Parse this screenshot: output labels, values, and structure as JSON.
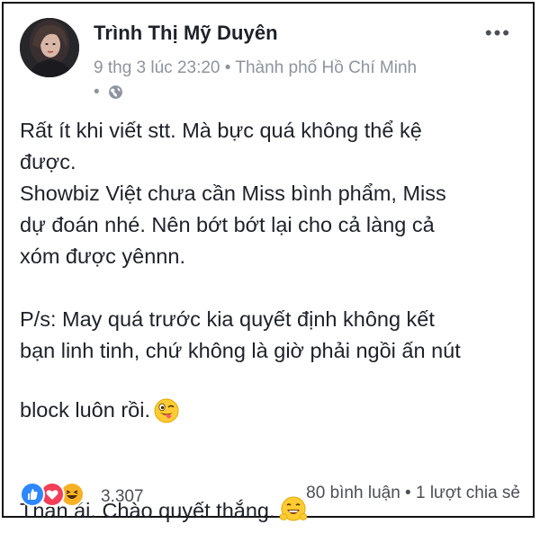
{
  "post": {
    "author": "Trình Thị Mỹ Duyên",
    "timestamp": "9 thg 3 lúc 23:20",
    "separator": "•",
    "location": "Thành phố Hồ Chí Minh",
    "privacy_separator": "•",
    "paragraphs": [
      "Rất ít khi viết stt. Mà bực quá không thể kệ\nđược.\nShowbiz Việt chưa cần Miss bình phẩm, Miss\ndự đoán nhé. Nên bớt bớt lại cho cả làng cả\nxóm được yênnn.",
      "P/s: May quá trước kia quyết định không kết\nbạn linh tinh, chứ không là giờ phải ngồi ấn nút\nblock luôn rồi.",
      "Thân ái. Chào quyết thắng."
    ]
  },
  "menu_icon": "more-options-icon",
  "privacy_icon": "globe-icon",
  "reactions": {
    "icons": [
      "like-icon",
      "love-icon",
      "haha-icon"
    ],
    "count": "3.307"
  },
  "stats": {
    "comments": "80 bình luận",
    "separator": "•",
    "shares": "1 lượt chia sẻ"
  },
  "colors": {
    "text": "#1d2129",
    "meta": "#8d949e",
    "like": "#2d88ff",
    "love": "#f33e58",
    "haha": "#f7b125"
  }
}
